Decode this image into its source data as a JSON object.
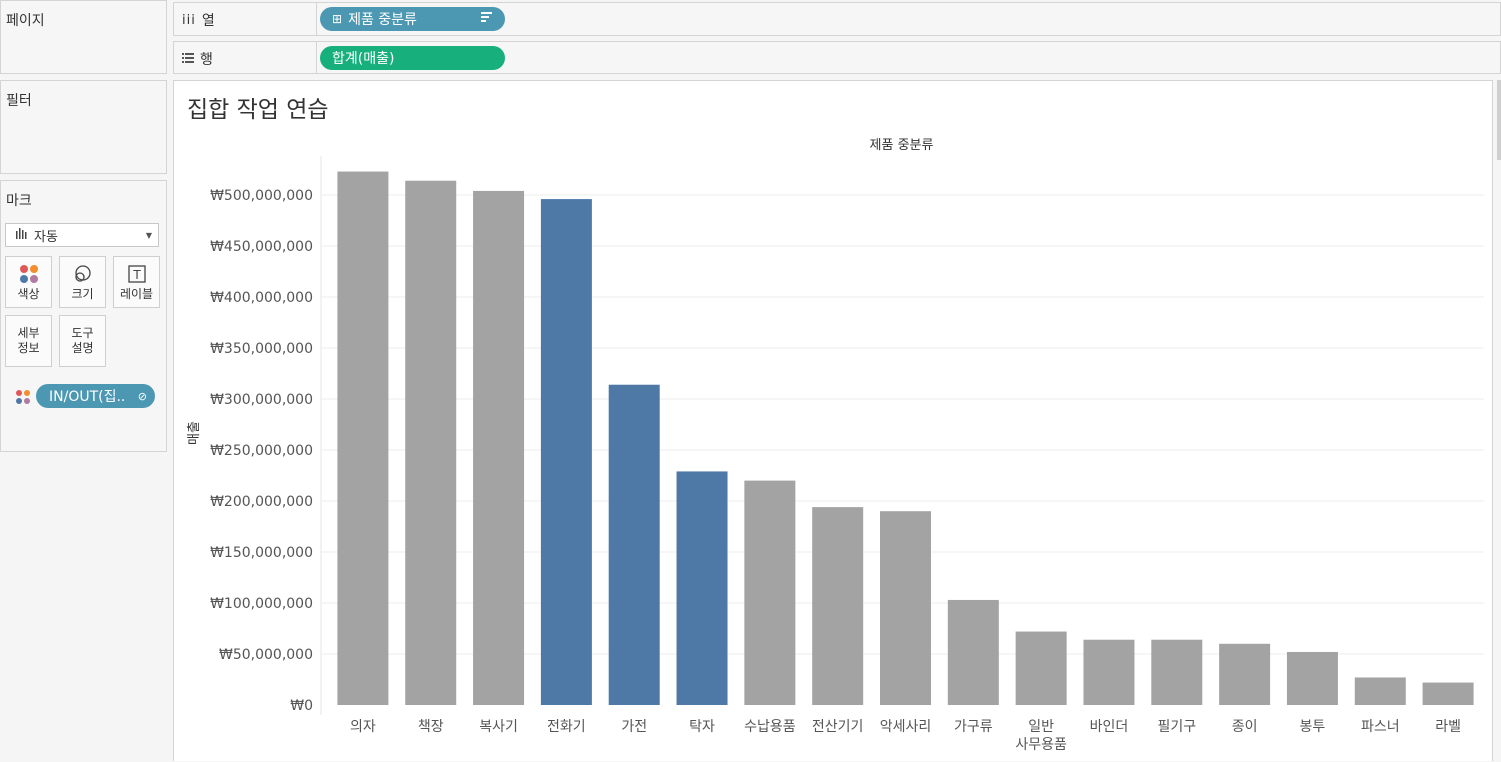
{
  "shelves": {
    "pages_title": "페이지",
    "columns_label": "열",
    "rows_label": "행",
    "column_pill": "제품 중분류",
    "row_pill": "합계(매출)"
  },
  "filters": {
    "title": "필터"
  },
  "marks": {
    "title": "마크",
    "type_select": "자동",
    "buttons": {
      "color": "색상",
      "size": "크기",
      "label": "레이블",
      "detail": "세부\n정보",
      "tooltip": "도구\n설명"
    },
    "color_pill": "IN/OUT(집.."
  },
  "viz": {
    "title": "집합 작업 연습",
    "column_header": "제품 중분류"
  },
  "colors": {
    "gray": "#a3a3a3",
    "blue": "#4e79a7",
    "pill_blue": "#4c98b3",
    "pill_green": "#17b07d"
  },
  "chart_data": {
    "type": "bar",
    "ylabel": "매출",
    "ylim": [
      0,
      550000000
    ],
    "yticks": [
      0,
      50000000,
      100000000,
      150000000,
      200000000,
      250000000,
      300000000,
      350000000,
      400000000,
      450000000,
      500000000
    ],
    "ytick_labels": [
      "₩0",
      "₩50,000,000",
      "₩100,000,000",
      "₩150,000,000",
      "₩200,000,000",
      "₩250,000,000",
      "₩300,000,000",
      "₩350,000,000",
      "₩400,000,000",
      "₩450,000,000",
      "₩500,000,000"
    ],
    "categories": [
      "의자",
      "책장",
      "복사기",
      "전화기",
      "가전",
      "탁자",
      "수납용품",
      "전산기기",
      "악세사리",
      "가구류",
      "일반\n사무용품",
      "바인더",
      "필기구",
      "종이",
      "봉투",
      "파스너",
      "라벨"
    ],
    "values": [
      523000000,
      514000000,
      504000000,
      496000000,
      314000000,
      229000000,
      220000000,
      194000000,
      190000000,
      103000000,
      72000000,
      64000000,
      64000000,
      60000000,
      52000000,
      27000000,
      22000000
    ],
    "highlighted": [
      false,
      false,
      false,
      true,
      true,
      true,
      false,
      false,
      false,
      false,
      false,
      false,
      false,
      false,
      false,
      false,
      false
    ],
    "grid": true
  }
}
